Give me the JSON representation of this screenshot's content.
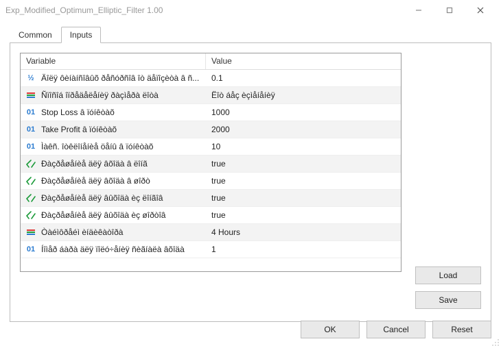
{
  "window": {
    "title": "Exp_Modified_Optimum_Elliptic_Filter 1.00"
  },
  "tabs": {
    "common": "Common",
    "inputs": "Inputs"
  },
  "grid": {
    "headers": {
      "variable": "Variable",
      "value": "Value"
    },
    "rows": [
      {
        "icon": "frac",
        "variable": "Äîëÿ ôèíàíñîâûõ ðåñóðñîâ îò äåïîçèòà â ñ...",
        "value": "0.1"
      },
      {
        "icon": "enum",
        "variable": "Ñïîñîá îïðåäåëåíèÿ ðàçìåðà ëîòà",
        "value": "Ëîò áåç èçìåíåíèÿ"
      },
      {
        "icon": "int",
        "variable": "Stop Loss â ïóíêòàõ",
        "value": "1000"
      },
      {
        "icon": "int",
        "variable": "Take Profit â ïóíêòàõ",
        "value": "2000"
      },
      {
        "icon": "int",
        "variable": "Ìàêñ. îòêëîíåíèå öåíû â ïóíêòàõ",
        "value": "10"
      },
      {
        "icon": "bool",
        "variable": "Ðàçðåøåíèå äëÿ âõîäà â ëîíã",
        "value": "true"
      },
      {
        "icon": "bool",
        "variable": "Ðàçðåøåíèå äëÿ âõîäà â øîðò",
        "value": "true"
      },
      {
        "icon": "bool",
        "variable": "Ðàçðåøåíèå äëÿ âûõîäà èç ëîíãîâ",
        "value": "true"
      },
      {
        "icon": "bool",
        "variable": "Ðàçðåøåíèå äëÿ âûõîäà èç øîðòîâ",
        "value": "true"
      },
      {
        "icon": "enum",
        "variable": "Òàéìôðåéì èíäèêàòîðà",
        "value": "4 Hours"
      },
      {
        "icon": "int",
        "variable": "Íîìåð áàðà äëÿ ïîëó÷åíèÿ ñèãíàëà âõîäà",
        "value": "1"
      }
    ]
  },
  "buttons": {
    "load": "Load",
    "save": "Save",
    "ok": "OK",
    "cancel": "Cancel",
    "reset": "Reset"
  }
}
